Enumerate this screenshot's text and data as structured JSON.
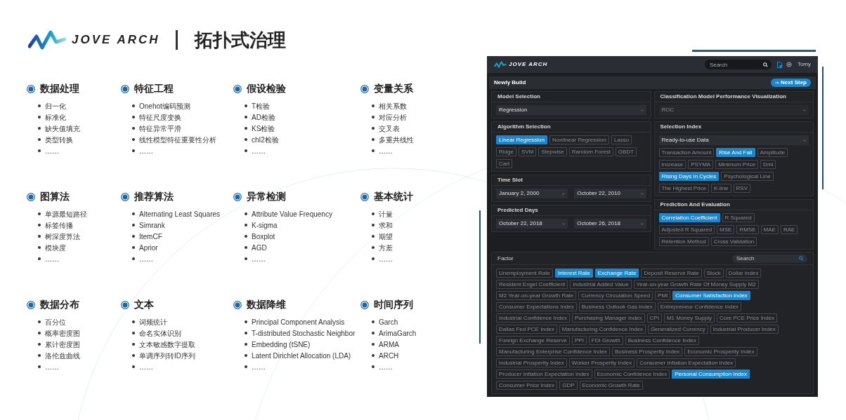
{
  "header": {
    "brand": "JOVE ARCH",
    "title": "拓扑式治理"
  },
  "categories": [
    {
      "title": "数据处理",
      "items": [
        "归一化",
        "标准化",
        "缺失值填充",
        "类型转换",
        "……"
      ]
    },
    {
      "title": "特征工程",
      "items": [
        "Onehot编码预测",
        "特征尺度变换",
        "特征异常平滑",
        "线性模型特征重要性分析",
        "……"
      ]
    },
    {
      "title": "假设检验",
      "items": [
        "T检验",
        "AD检验",
        "KS检验",
        "chI2检验",
        "……"
      ]
    },
    {
      "title": "变量关系",
      "items": [
        "相关系数",
        "对应分析",
        "交叉表",
        "多重共线性",
        "……"
      ]
    },
    {
      "title": "图算法",
      "items": [
        "单源最短路径",
        "标签传播",
        "树深度算法",
        "模块度",
        "……"
      ]
    },
    {
      "title": "推荐算法",
      "items": [
        "Alternating Least Squares",
        "Simrank",
        "ItemCF",
        "Aprior",
        "……"
      ]
    },
    {
      "title": "异常检测",
      "items": [
        "Attribute Value Frequency",
        "K-sigma",
        "Boxplot",
        "AGD",
        "……"
      ]
    },
    {
      "title": "基本统计",
      "items": [
        "计量",
        "求和",
        "期望",
        "方差",
        "……"
      ]
    },
    {
      "title": "数据分布",
      "items": [
        "百分位",
        "概率密度图",
        "累计密度图",
        "洛伦兹曲线",
        "……"
      ]
    },
    {
      "title": "文本",
      "items": [
        "词频统计",
        "命名实体识别",
        "文本敏感数字提取",
        "单调序列转ID序列",
        "……"
      ]
    },
    {
      "title": "数据降维",
      "items": [
        "Principal Component Analysis",
        "T-distributed Stochastic Neighbor",
        "Embedding (tSNE)",
        "Latent Dirichlet Allocation (LDA)",
        "……"
      ]
    },
    {
      "title": "时间序列",
      "items": [
        "Garch",
        "ArimaGarch",
        "ARMA",
        "ARCH",
        "……"
      ]
    }
  ],
  "app": {
    "brand": "JOVE ARCH",
    "search": {
      "placeholder": "Search"
    },
    "user": "Tomy",
    "page_title": "Newly Build",
    "next_button": "Next Step",
    "left_panels": [
      {
        "title": "Model Selection",
        "dropdowns": [
          {
            "value": "Regression",
            "disabled": false
          }
        ]
      },
      {
        "title": "Algorithm Selection",
        "chips": [
          {
            "label": "Linear Regression",
            "selected": true
          },
          {
            "label": "Nonlinear Regression",
            "selected": false
          },
          {
            "label": "Lasso",
            "selected": false
          },
          {
            "label": "Ridge",
            "selected": false
          },
          {
            "label": "SVM",
            "selected": false
          },
          {
            "label": "Stepwise",
            "selected": false
          },
          {
            "label": "Random Forest",
            "selected": false
          },
          {
            "label": "GBDT",
            "selected": false
          },
          {
            "label": "Cart",
            "selected": false
          }
        ]
      },
      {
        "title": "Time Slot",
        "dropdowns": [
          {
            "value": "January 2, 2000",
            "disabled": false
          },
          {
            "value": "October 22, 2010",
            "disabled": false
          }
        ]
      },
      {
        "title": "Predicted Days",
        "dropdowns": [
          {
            "value": "October 22, 2018",
            "disabled": false
          },
          {
            "value": "October 26, 2018",
            "disabled": false
          }
        ]
      }
    ],
    "right_panels": [
      {
        "title": "Classification Model Performance Visualization",
        "dropdowns": [
          {
            "value": "ROC",
            "disabled": true
          }
        ]
      },
      {
        "title": "Selection Index",
        "dropdowns": [
          {
            "value": "Ready-to-use Data",
            "disabled": false
          }
        ],
        "chips": [
          {
            "label": "Transaction Amount",
            "selected": false
          },
          {
            "label": "Rise And Fall",
            "selected": true
          },
          {
            "label": "Amplitude",
            "selected": false
          },
          {
            "label": "Increase",
            "selected": false
          },
          {
            "label": "PSYMA",
            "selected": false
          },
          {
            "label": "Minimum Price",
            "selected": false
          },
          {
            "label": "Dmi",
            "selected": false
          },
          {
            "label": "Rising Days In Cycles",
            "selected": true
          },
          {
            "label": "Psychological Line",
            "selected": false
          },
          {
            "label": "The Highest Price",
            "selected": false
          },
          {
            "label": "K-line",
            "selected": false
          },
          {
            "label": "RSV",
            "selected": false
          }
        ]
      },
      {
        "title": "Prediction And Evaluation",
        "chips": [
          {
            "label": "Correlation Coefficient",
            "selected": true
          },
          {
            "label": "R Squared",
            "selected": false
          },
          {
            "label": "Adjusted R Squared",
            "selected": false
          },
          {
            "label": "MSE",
            "selected": false
          },
          {
            "label": "RMSE",
            "selected": false
          },
          {
            "label": "MAE",
            "selected": false
          },
          {
            "label": "RAE",
            "selected": false
          },
          {
            "label": "Retention Method",
            "selected": false
          },
          {
            "label": "Cross Validation",
            "selected": false
          }
        ]
      }
    ],
    "factor": {
      "title": "Factor",
      "search": {
        "placeholder": "Search"
      },
      "chips": [
        {
          "label": "Unemployment Rate",
          "selected": false
        },
        {
          "label": "Interest Rate",
          "selected": true
        },
        {
          "label": "Exchange Rate",
          "selected": true
        },
        {
          "label": "Deposit Reserve Rate",
          "selected": false
        },
        {
          "label": "Stock",
          "selected": false
        },
        {
          "label": "Dollar Index",
          "selected": false
        },
        {
          "label": "Resident Engel Coefficient",
          "selected": false
        },
        {
          "label": "Industrial Added Value",
          "selected": false
        },
        {
          "label": "Year-on-year Growth Rate Of Money Supply M2",
          "selected": false
        },
        {
          "label": "M2 Year-on-year Growth Rate",
          "selected": false
        },
        {
          "label": "Currency Circulation Speed",
          "selected": false
        },
        {
          "label": "PMI",
          "selected": false
        },
        {
          "label": "Consumer Satisfaction Index",
          "selected": true
        },
        {
          "label": "Consumer Expectations Index",
          "selected": false
        },
        {
          "label": "Business Outlook Gas Index",
          "selected": false
        },
        {
          "label": "Entrepreneur Confidence Index",
          "selected": false
        },
        {
          "label": "Industrial Confidence Index",
          "selected": false
        },
        {
          "label": "Purchasing Manager Index",
          "selected": false
        },
        {
          "label": "CPI",
          "selected": false
        },
        {
          "label": "M1 Money Supply",
          "selected": false
        },
        {
          "label": "Core PCE Price Index",
          "selected": false
        },
        {
          "label": "Dallas Fed PCE Index",
          "selected": false
        },
        {
          "label": "Manufacturing Confidence Index",
          "selected": false
        },
        {
          "label": "Generalized Currency",
          "selected": false
        },
        {
          "label": "Industrial Producer Index",
          "selected": false
        },
        {
          "label": "Foreign Exchange Reserve",
          "selected": false
        },
        {
          "label": "PPI",
          "selected": false
        },
        {
          "label": "FDI Growth",
          "selected": false
        },
        {
          "label": "Business Confidence Index",
          "selected": false
        },
        {
          "label": "Manufacturing Enterprise Confidence Index",
          "selected": false
        },
        {
          "label": "Business Prosperity Index",
          "selected": false
        },
        {
          "label": "Economic Prosperity Index",
          "selected": false
        },
        {
          "label": "Industrial Prosperity Index",
          "selected": false
        },
        {
          "label": "Worker Prosperity Index",
          "selected": false
        },
        {
          "label": "Consumer Inflation Expectation Index",
          "selected": false
        },
        {
          "label": "Producer Inflation Expectation Index",
          "selected": false
        },
        {
          "label": "Economic Confidence Index",
          "selected": false
        },
        {
          "label": "Personal Consumption Index",
          "selected": true
        },
        {
          "label": "Consumer Price Index",
          "selected": false
        },
        {
          "label": "GDP",
          "selected": false
        },
        {
          "label": "Economic Growth Rate",
          "selected": false
        }
      ]
    }
  }
}
